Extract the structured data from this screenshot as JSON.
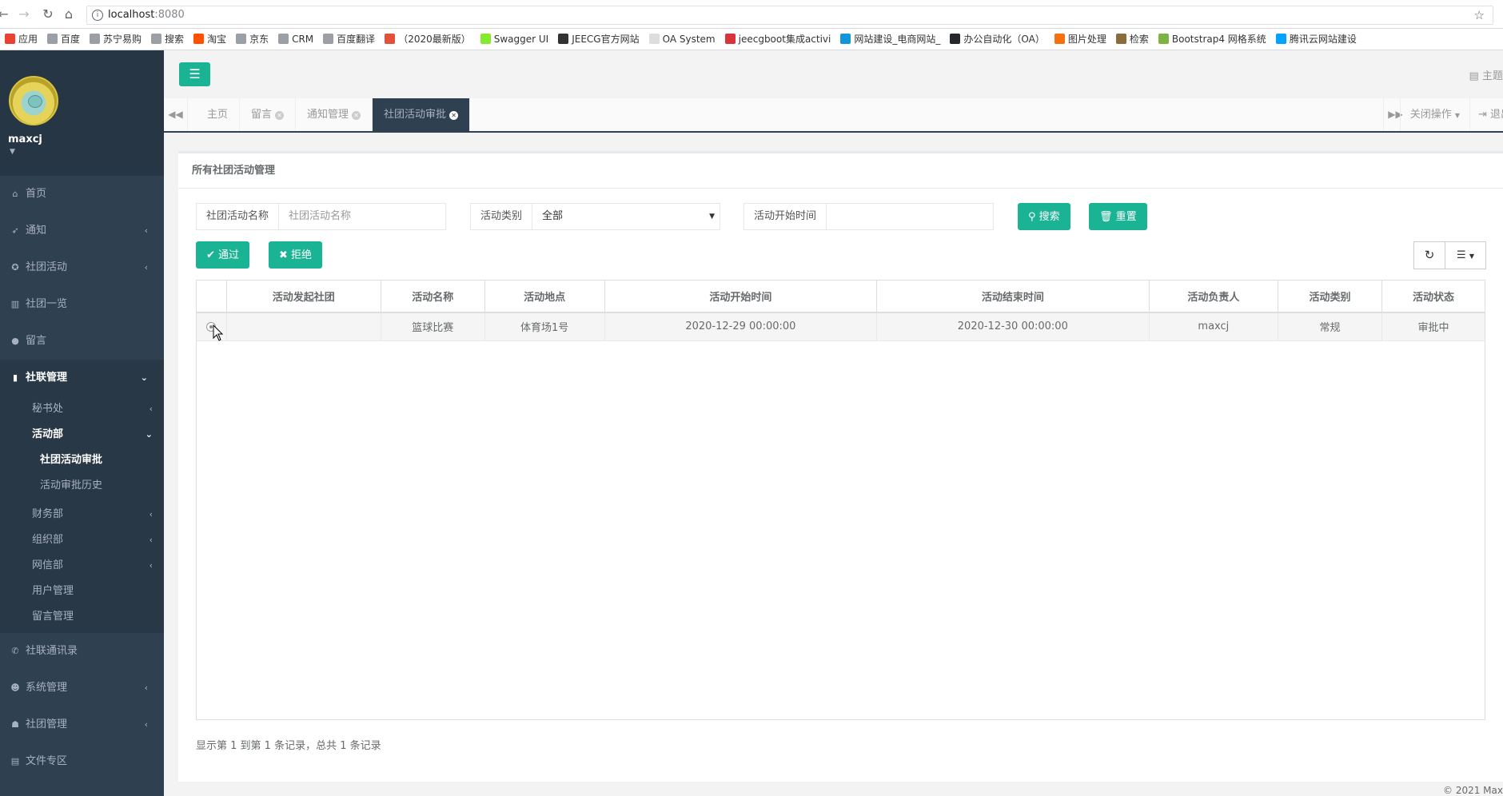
{
  "browser": {
    "url_host": "localhost",
    "url_port": ":8080",
    "bookmarks": [
      {
        "label": "应用",
        "color": "#e94235"
      },
      {
        "label": "百度",
        "color": "#9aa0a6"
      },
      {
        "label": "苏宁易购",
        "color": "#9aa0a6"
      },
      {
        "label": "搜索",
        "color": "#9aa0a6"
      },
      {
        "label": "淘宝",
        "color": "#ff5000"
      },
      {
        "label": "京东",
        "color": "#9aa0a6"
      },
      {
        "label": "CRM",
        "color": "#9aa0a6"
      },
      {
        "label": "百度翻译",
        "color": "#9aa0a6"
      },
      {
        "label": "（2020最新版）",
        "color": "#e4503a"
      },
      {
        "label": "Swagger UI",
        "color": "#85ea2d"
      },
      {
        "label": "JEECG官方网站",
        "color": "#333333"
      },
      {
        "label": "OA System",
        "color": "#dddddd"
      },
      {
        "label": "jeecgboot集成activi",
        "color": "#d9343a"
      },
      {
        "label": "网站建设_电商网站_",
        "color": "#1296db"
      },
      {
        "label": "办公自动化（OA）",
        "color": "#24292e"
      },
      {
        "label": "图片处理",
        "color": "#f6700f"
      },
      {
        "label": "检索",
        "color": "#8a6d3b"
      },
      {
        "label": "Bootstrap4 网格系统",
        "color": "#7cb342"
      },
      {
        "label": "腾讯云网站建设",
        "color": "#00a3ff"
      }
    ]
  },
  "sidebar": {
    "username": "maxcj",
    "items": [
      {
        "label": "首页",
        "icon": "home-icon",
        "glyph": "⌂",
        "arrow": ""
      },
      {
        "label": "通知",
        "icon": "rocket-icon",
        "glyph": "➶",
        "arrow": "‹"
      },
      {
        "label": "社团活动",
        "icon": "medal-icon",
        "glyph": "✪",
        "arrow": "‹"
      },
      {
        "label": "社团一览",
        "icon": "bank-icon",
        "glyph": "▥",
        "arrow": ""
      },
      {
        "label": "留言",
        "icon": "comment-icon",
        "glyph": "●",
        "arrow": ""
      },
      {
        "label": "社联管理",
        "icon": "bookmark-icon",
        "glyph": "▮",
        "arrow": "⌄"
      }
    ],
    "submenu": {
      "secretariat": {
        "label": "秘书处",
        "arrow": "‹"
      },
      "activity_dept": {
        "label": "活动部",
        "arrow": "⌄"
      },
      "activity_children": [
        "社团活动审批",
        "活动审批历史"
      ],
      "others": [
        {
          "label": "财务部",
          "arrow": "‹"
        },
        {
          "label": "组织部",
          "arrow": "‹"
        },
        {
          "label": "网信部",
          "arrow": "‹"
        },
        {
          "label": "用户管理",
          "arrow": ""
        },
        {
          "label": "留言管理",
          "arrow": ""
        }
      ]
    },
    "bottom_items": [
      {
        "label": "社联通讯录",
        "icon": "phone-icon",
        "glyph": "✆",
        "arrow": ""
      },
      {
        "label": "系统管理",
        "icon": "user-icon",
        "glyph": "☻",
        "arrow": "‹"
      },
      {
        "label": "社团管理",
        "icon": "users-icon",
        "glyph": "☗",
        "arrow": "‹"
      },
      {
        "label": "文件专区",
        "icon": "file-icon",
        "glyph": "▤",
        "arrow": ""
      }
    ]
  },
  "header": {
    "theme_label": "主题"
  },
  "tabs": {
    "items": [
      "主页",
      "留言",
      "通知管理",
      "社团活动审批"
    ],
    "close_ops": "关闭操作",
    "logout": "退出"
  },
  "panel": {
    "title": "所有社团活动管理",
    "filters": {
      "name_label": "社团活动名称",
      "name_placeholder": "社团活动名称",
      "type_label": "活动类别",
      "type_value": "全部",
      "start_label": "活动开始时间",
      "start_value": ""
    },
    "buttons": {
      "search": "搜索",
      "reset": "重置",
      "approve": "通过",
      "reject": "拒绝"
    },
    "table": {
      "columns": [
        "活动发起社团",
        "活动名称",
        "活动地点",
        "活动开始时间",
        "活动结束时间",
        "活动负责人",
        "活动类别",
        "活动状态"
      ],
      "rows": [
        [
          "",
          "篮球比赛",
          "体育场1号",
          "2020-12-29 00:00:00",
          "2020-12-30 00:00:00",
          "maxcj",
          "常规",
          "审批中"
        ]
      ]
    },
    "pager_info": "显示第 1 到第 1 条记录，总共 1 条记录",
    "footer": "© 2021 Max"
  }
}
